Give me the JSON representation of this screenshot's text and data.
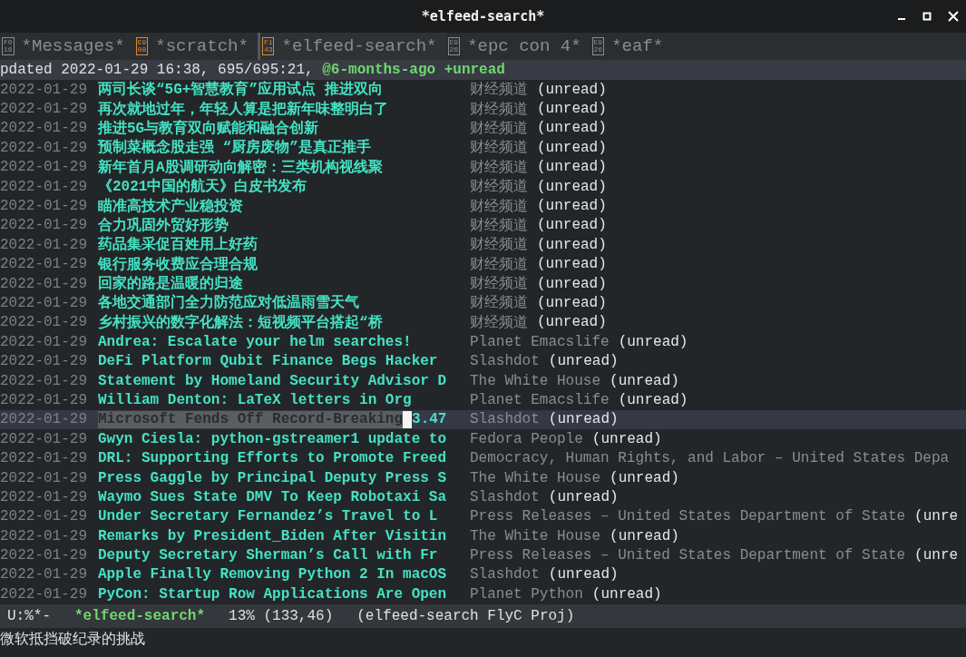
{
  "window": {
    "title": "*elfeed-search*"
  },
  "tabs": [
    {
      "icon_code": "F016",
      "label": "*Messages*",
      "selected": false,
      "color": "#8a8d90"
    },
    {
      "icon_code": "E908",
      "label": "*scratch*",
      "selected": false,
      "color": "#d98a3a"
    },
    {
      "icon_code": "F143",
      "label": "*elfeed-search*",
      "selected": true,
      "color": "#d98a3a"
    },
    {
      "icon_code": "E926",
      "label": "*epc con 4*",
      "selected": false,
      "color": "#8a8d90"
    },
    {
      "icon_code": "E926",
      "label": "*eaf*",
      "selected": false,
      "color": "#8a8d90"
    }
  ],
  "header": {
    "text": "pdated 2022-01-29 16:38, 695/695:21, ",
    "filter": "@6-months-ago +unread"
  },
  "entries": [
    {
      "date": "2022-01-29",
      "title": "两司长谈“5G+智慧教育”应用试点 推进双向",
      "feed": "财经频道",
      "tag": "(unread)",
      "selected": false
    },
    {
      "date": "2022-01-29",
      "title": "再次就地过年，年轻人算是把新年味整明白了",
      "feed": "财经频道",
      "tag": "(unread)",
      "selected": false
    },
    {
      "date": "2022-01-29",
      "title": "推进5G与教育双向赋能和融合创新",
      "feed": "财经频道",
      "tag": "(unread)",
      "selected": false
    },
    {
      "date": "2022-01-29",
      "title": "预制菜概念股走强 “厨房废物”是真正推手",
      "feed": "财经频道",
      "tag": "(unread)",
      "selected": false
    },
    {
      "date": "2022-01-29",
      "title": "新年首月A股调研动向解密：三类机构视线聚",
      "feed": "财经频道",
      "tag": "(unread)",
      "selected": false
    },
    {
      "date": "2022-01-29",
      "title": "《2021中国的航天》白皮书发布",
      "feed": "财经频道",
      "tag": "(unread)",
      "selected": false
    },
    {
      "date": "2022-01-29",
      "title": "瞄准高技术产业稳投资",
      "feed": "财经频道",
      "tag": "(unread)",
      "selected": false
    },
    {
      "date": "2022-01-29",
      "title": "合力巩固外贸好形势",
      "feed": "财经频道",
      "tag": "(unread)",
      "selected": false
    },
    {
      "date": "2022-01-29",
      "title": "药品集采促百姓用上好药",
      "feed": "财经频道",
      "tag": "(unread)",
      "selected": false
    },
    {
      "date": "2022-01-29",
      "title": "银行服务收费应合理合规",
      "feed": "财经频道",
      "tag": "(unread)",
      "selected": false
    },
    {
      "date": "2022-01-29",
      "title": "回家的路是温暖的归途",
      "feed": "财经频道",
      "tag": "(unread)",
      "selected": false
    },
    {
      "date": "2022-01-29",
      "title": "各地交通部门全力防范应对低温雨雪天气",
      "feed": "财经频道",
      "tag": "(unread)",
      "selected": false
    },
    {
      "date": "2022-01-29",
      "title": "乡村振兴的数字化解法：短视频平台搭起“桥",
      "feed": "财经频道",
      "tag": "(unread)",
      "selected": false
    },
    {
      "date": "2022-01-29",
      "title": "Andrea: Escalate your helm searches!",
      "feed": "Planet Emacslife",
      "tag": "(unread)",
      "selected": false
    },
    {
      "date": "2022-01-29",
      "title": "DeFi Platform Qubit Finance Begs Hacker",
      "feed": "Slashdot",
      "tag": "(unread)",
      "selected": false
    },
    {
      "date": "2022-01-29",
      "title": "Statement by Homeland Security Advisor D",
      "feed": "The White House",
      "tag": "(unread)",
      "selected": false
    },
    {
      "date": "2022-01-29",
      "title": "William Denton: LaTeX letters in Org",
      "feed": "Planet Emacslife",
      "tag": "(unread)",
      "selected": false
    },
    {
      "date": "2022-01-29",
      "title": "Microsoft Fends Off Record-Breaking",
      "title_tail": "3.47",
      "feed": "Slashdot",
      "tag": "(unread)",
      "selected": true
    },
    {
      "date": "2022-01-29",
      "title": "Gwyn Ciesla: python-gstreamer1 update to",
      "feed": "Fedora People",
      "tag": "(unread)",
      "selected": false
    },
    {
      "date": "2022-01-29",
      "title": "DRL: Supporting Efforts to Promote Freed",
      "feed": "Democracy, Human Rights, and Labor – United States Depa",
      "selected": false
    },
    {
      "date": "2022-01-29",
      "title": "Press Gaggle by Principal Deputy Press S",
      "feed": "The White House",
      "tag": "(unread)",
      "selected": false
    },
    {
      "date": "2022-01-29",
      "title": "Waymo Sues State DMV To Keep Robotaxi Sa",
      "feed": "Slashdot",
      "tag": "(unread)",
      "selected": false
    },
    {
      "date": "2022-01-29",
      "title": "Under Secretary Fernandez’s Travel to L",
      "feed": "Press Releases – United States Department of State",
      "tag": "(unre",
      "selected": false
    },
    {
      "date": "2022-01-29",
      "title": "Remarks by President_Biden After Visitin",
      "feed": "The White House",
      "tag": "(unread)",
      "selected": false
    },
    {
      "date": "2022-01-29",
      "title": "Deputy Secretary Sherman’s Call with Fr",
      "feed": "Press Releases – United States Department of State",
      "tag": "(unre",
      "selected": false
    },
    {
      "date": "2022-01-29",
      "title": "Apple Finally Removing Python 2 In macOS",
      "feed": "Slashdot",
      "tag": "(unread)",
      "selected": false
    },
    {
      "date": "2022-01-29",
      "title": "PyCon: Startup Row Applications Are Open",
      "feed": "Planet Python",
      "tag": "(unread)",
      "selected": false
    }
  ],
  "mode_line": {
    "state": "U:%*-",
    "buffer": "*elfeed-search*",
    "position": "13% (133,46)",
    "modes": "(elfeed-search FlyC Proj)"
  },
  "echo_area": "微软抵挡破纪录的挑战"
}
